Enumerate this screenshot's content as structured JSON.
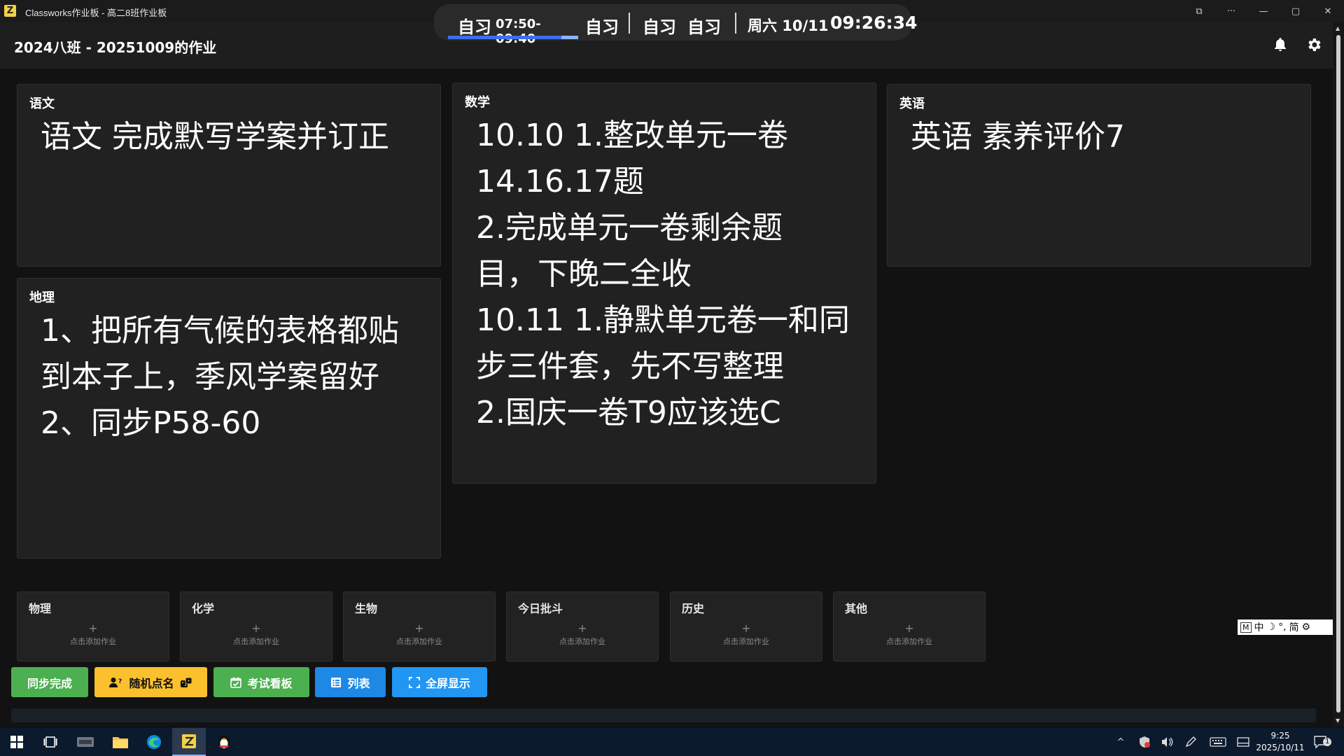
{
  "window": {
    "title": "Classworks作业板 - 高二8班作业板",
    "app_icon_glyph": "Z",
    "buttons": [
      "⧉",
      "···",
      "—",
      "▢",
      "✕"
    ]
  },
  "timer": {
    "current_label": "自习",
    "current_range": "07:50-09:40",
    "progress_fraction": 0.87,
    "next": [
      "自习",
      "自习",
      "自习"
    ],
    "day": "周六 10/11",
    "clock": "09:26:34"
  },
  "header": {
    "title": "2024八班 - 20251009的作业",
    "bell_icon": "bell-icon",
    "settings_icon": "gear-icon"
  },
  "cards": [
    {
      "subject": "语文",
      "content": "语文 完成默写学案并订正"
    },
    {
      "subject": "数学",
      "content": "10.10 1.整改单元一卷\n14.16.17题\n2.完成单元一卷剩余题\n目，下晚二全收\n10.11 1.静默单元卷一和同\n步三件套，先不写整理\n2.国庆一卷T9应该选C"
    },
    {
      "subject": "英语",
      "content": "英语 素养评价7"
    },
    {
      "subject": "地理",
      "content": "1、把所有气候的表格都贴\n到本子上，季风学案留好\n2、同步P58-60"
    }
  ],
  "empty_cards": [
    {
      "subject": "物理",
      "plus": "+",
      "hint": "点击添加作业"
    },
    {
      "subject": "化学",
      "plus": "+",
      "hint": "点击添加作业"
    },
    {
      "subject": "生物",
      "plus": "+",
      "hint": "点击添加作业"
    },
    {
      "subject": "今日批斗",
      "plus": "+",
      "hint": "点击添加作业"
    },
    {
      "subject": "历史",
      "plus": "+",
      "hint": "点击添加作业"
    },
    {
      "subject": "其他",
      "plus": "+",
      "hint": "点击添加作业"
    }
  ],
  "actions": {
    "sync": "同步完成",
    "random": "随机点名",
    "exam": "考试看板",
    "list": "列表",
    "fullscreen": "全屏显示"
  },
  "ime": {
    "mode": "M",
    "lang": "中",
    "moon": "☽",
    "punct": "°,",
    "script": "简",
    "gear": "⚙"
  },
  "taskbar": {
    "time": "9:25",
    "date": "2025/10/11",
    "notifications": "1"
  },
  "colors": {
    "green": "#4caf50",
    "yellow": "#fbc02d",
    "blue": "#1e88e5",
    "progress": "#3f6ee8"
  }
}
